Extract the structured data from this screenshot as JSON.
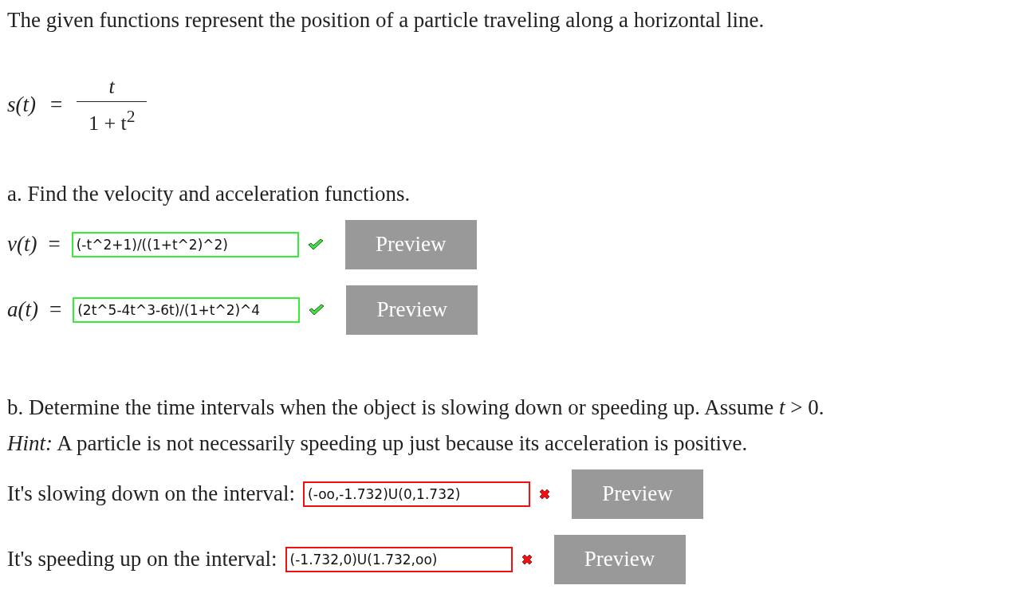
{
  "intro": "The given functions represent the position of a particle traveling along a horizontal line.",
  "function": {
    "lhs": "s(t)",
    "equals": "=",
    "numerator": "t",
    "denominator": "1 + t$^{2}$"
  },
  "part_a": {
    "prompt": "a. Find the velocity and acceleration functions.",
    "answers": [
      {
        "lhs": "v(t)",
        "equals": "=",
        "value": "(-t^2+1)/((1+t^2)^2)",
        "correct": true,
        "button": "Preview"
      },
      {
        "lhs": "a(t)",
        "equals": "=",
        "value": "(2t^5-4t^3-6t)/(1+t^2)^4",
        "correct": true,
        "button": "Preview"
      }
    ]
  },
  "part_b": {
    "prompt": "b. Determine the time intervals when the object is slowing down or speeding up. Assume *t* > 0.",
    "hint": "*Hint:* A particle is not necessarily speeding up just because its acceleration is positive.",
    "answers": [
      {
        "label": "It's slowing down on the interval:",
        "value": "(-oo,-1.732)U(0,1.732)",
        "correct": false,
        "button": "Preview"
      },
      {
        "label": "It's speeding up on the interval:",
        "value": "(-1.732,0)U(1.732,oo)",
        "correct": false,
        "button": "Preview"
      }
    ]
  }
}
